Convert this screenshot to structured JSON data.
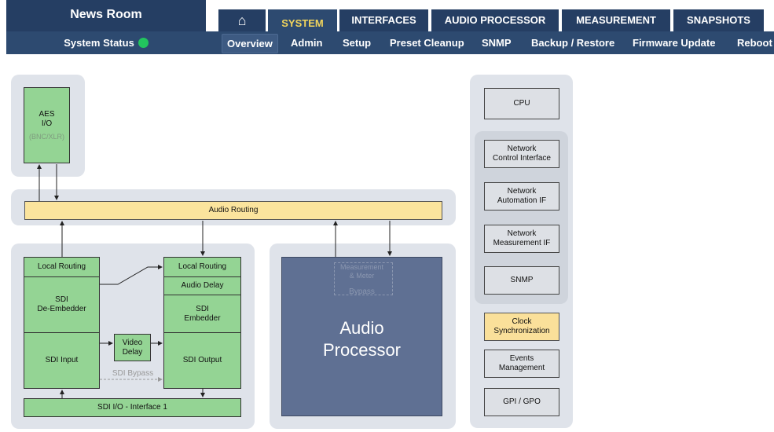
{
  "header": {
    "title": "News Room",
    "tabs": [
      {
        "label": "⌂",
        "icon": "home-icon"
      },
      {
        "label": "SYSTEM"
      },
      {
        "label": "INTERFACES"
      },
      {
        "label": "AUDIO PROCESSOR"
      },
      {
        "label": "MEASUREMENT"
      },
      {
        "label": "SNAPSHOTS"
      }
    ],
    "active_tab": "SYSTEM"
  },
  "subnav": {
    "status_label": "System Status",
    "items": [
      "Overview",
      "Admin",
      "Setup",
      "Preset Cleanup",
      "SNMP",
      "Backup / Restore",
      "Firmware Update",
      "Reboot"
    ],
    "active": "Overview"
  },
  "diagram": {
    "aes": {
      "line1": "AES",
      "line2": "I/O",
      "sub": "(BNC/XLR)"
    },
    "audio_routing": "Audio Routing",
    "left_group": {
      "local_routing_in": "Local Routing",
      "sdi_demb_1": "SDI",
      "sdi_demb_2": "De-Embedder",
      "sdi_input": "SDI Input",
      "video_delay_1": "Video",
      "video_delay_2": "Delay",
      "sdi_bypass": "SDI Bypass",
      "local_routing_out": "Local Routing",
      "audio_delay": "Audio Delay",
      "sdi_emb_1": "SDI",
      "sdi_emb_2": "Embedder",
      "sdi_output": "SDI Output",
      "sdi_io": "SDI I/O - Interface 1"
    },
    "audio_processor": {
      "meas_1": "Measurement",
      "meas_2": "& Meter",
      "bypass": "Bypass",
      "title_1": "Audio",
      "title_2": "Processor"
    },
    "right_group": {
      "cpu": "CPU",
      "nci_1": "Network",
      "nci_2": "Control Interface",
      "nai_1": "Network",
      "nai_2": "Automation IF",
      "nmi_1": "Network",
      "nmi_2": "Measurement IF",
      "snmp": "SNMP",
      "clock_1": "Clock",
      "clock_2": "Synchronization",
      "events_1": "Events",
      "events_2": "Management",
      "gpio": "GPI / GPO"
    }
  },
  "colors": {
    "nav_dark": "#253e63",
    "nav_sub": "#2d4a70",
    "active_tab_text": "#f2d55c",
    "status_ok": "#22c55e",
    "green_block": "#94d494",
    "yellow_block": "#fae09a",
    "processor_block": "#5f7093"
  }
}
